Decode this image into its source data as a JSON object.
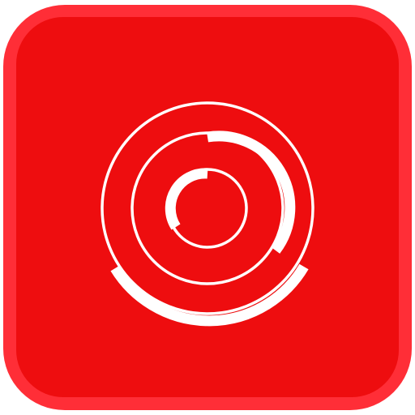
{
  "icon": {
    "name": "concentric-rings-logo",
    "outer_color": "#ff2e37",
    "inner_color": "#ee0d0f",
    "mark_color": "#ffffff"
  }
}
